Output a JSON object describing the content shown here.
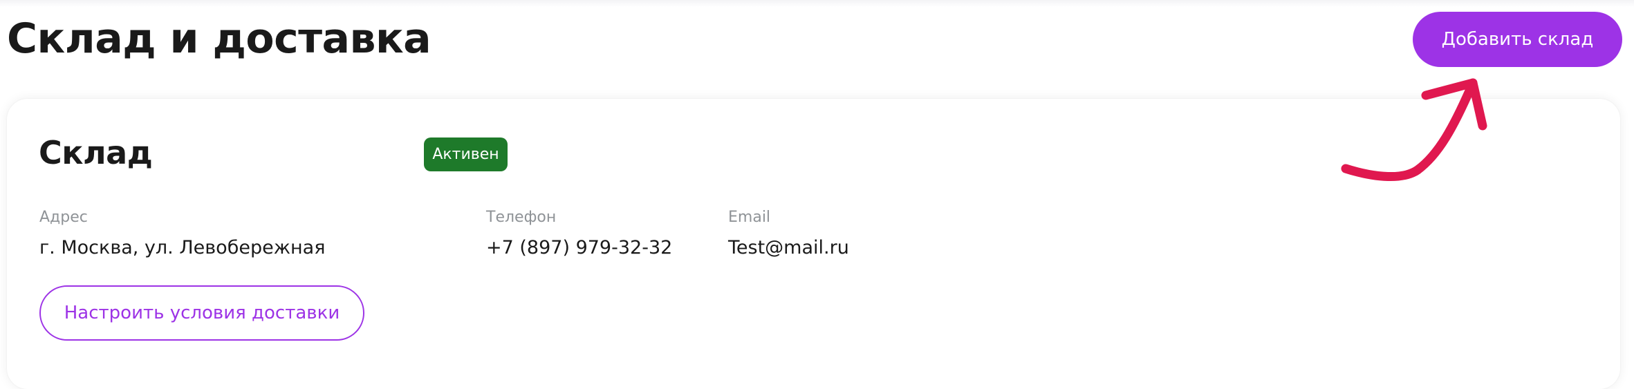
{
  "header": {
    "title": "Склад и доставка",
    "add_warehouse_label": "Добавить склад"
  },
  "warehouse": {
    "name": "Склад",
    "status": "Активен",
    "fields": [
      {
        "label": "Адрес",
        "value": "г. Москва, ул. Левобережная"
      },
      {
        "label": "Телефон",
        "value": "+7 (897) 979-32-32"
      },
      {
        "label": "Email",
        "value": "Test@mail.ru"
      }
    ],
    "delivery_button_label": "Настроить условия доставки"
  },
  "colors": {
    "accent": "#9d33e6",
    "status_active": "#1e7a2a",
    "annotation_arrow": "#e0184f",
    "muted_text": "#8f9397"
  },
  "icons": {
    "annotation": "curved-arrow-icon"
  }
}
